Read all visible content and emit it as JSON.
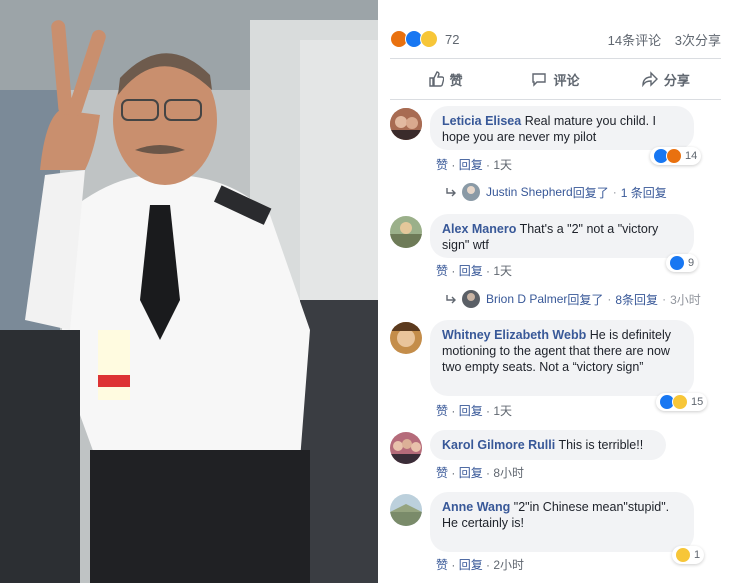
{
  "post": {
    "reaction_count": "72",
    "comments_count": "14条评论",
    "shares_count": "3次分享"
  },
  "actions": {
    "like": "赞",
    "comment": "评论",
    "share": "分享"
  },
  "comments": [
    {
      "author": "Leticia Elisea",
      "text": "Real mature you child. I hope you are never my pilot",
      "like": "赞",
      "reply": "回复",
      "time": "1天",
      "reactions": "14",
      "reply_summary": {
        "author": "Justin Shepherd",
        "action": "回复了",
        "count": "1 条回复",
        "time": ""
      }
    },
    {
      "author": "Alex Manero",
      "text": "That's a \"2\" not a \"victory sign\" wtf",
      "like": "赞",
      "reply": "回复",
      "time": "1天",
      "reactions": "9",
      "reply_summary": {
        "author": "Brion D Palmer",
        "action": "回复了",
        "count": "8条回复",
        "time": "3小时"
      }
    },
    {
      "author": "Whitney Elizabeth Webb",
      "text": "He is definitely motioning to the agent that there are now two empty seats. Not a “victory sign”",
      "like": "赞",
      "reply": "回复",
      "time": "1天",
      "reactions": "15"
    },
    {
      "author": "Karol Gilmore Rulli",
      "text": "This is terrible!!",
      "like": "赞",
      "reply": "回复",
      "time": "8小时"
    },
    {
      "author": "Anne Wang",
      "text": "\"2\"in Chinese mean\"stupid\". He certainly is!",
      "like": "赞",
      "reply": "回复",
      "time": "2小时",
      "reactions": "1"
    }
  ],
  "colors": {
    "link": "#385898",
    "bubble": "#f2f3f5",
    "like_blue": "#1877f2",
    "angry": "#e9710f",
    "haha": "#f7c638"
  }
}
